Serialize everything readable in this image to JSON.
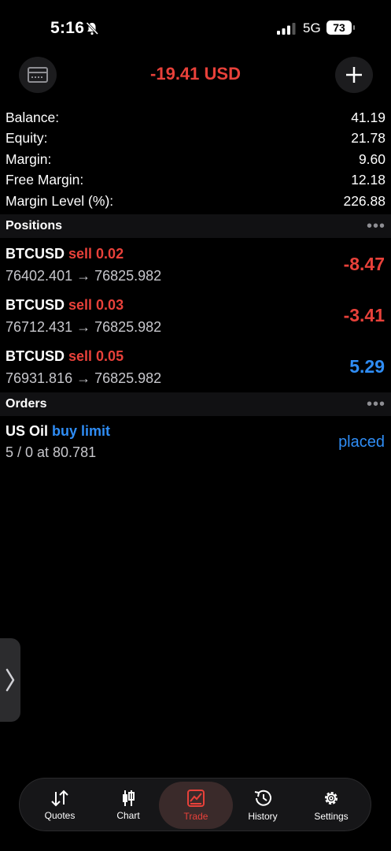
{
  "status_bar": {
    "time": "5:16",
    "network": "5G",
    "battery": "73"
  },
  "header": {
    "title": "-19.41 USD"
  },
  "summary": [
    {
      "label": "Balance:",
      "value": "41.19"
    },
    {
      "label": "Equity:",
      "value": "21.78"
    },
    {
      "label": "Margin:",
      "value": "9.60"
    },
    {
      "label": "Free Margin:",
      "value": "12.18"
    },
    {
      "label": "Margin Level (%):",
      "value": "226.88"
    }
  ],
  "positions": {
    "title": "Positions",
    "items": [
      {
        "symbol": "BTCUSD",
        "direction": "sell 0.02",
        "prices": "76402.401 → 76825.982",
        "profit": "-8.47"
      },
      {
        "symbol": "BTCUSD",
        "direction": "sell 0.03",
        "prices": "76712.431 → 76825.982",
        "profit": "-3.41"
      },
      {
        "symbol": "BTCUSD",
        "direction": "sell 0.05",
        "prices": "76931.816 → 76825.982",
        "profit": "5.29"
      }
    ]
  },
  "orders": {
    "title": "Orders",
    "items": [
      {
        "symbol": "US Oil",
        "direction": "buy limit",
        "details": "5 / 0 at 80.781",
        "state": "placed"
      }
    ]
  },
  "tabbar": {
    "tabs": [
      {
        "label": "Quotes",
        "icon": "quotes-arrows-icon"
      },
      {
        "label": "Chart",
        "icon": "candlestick-icon"
      },
      {
        "label": "Trade",
        "icon": "trade-chart-icon",
        "active": true
      },
      {
        "label": "History",
        "icon": "history-clock-icon"
      },
      {
        "label": "Settings",
        "icon": "gear-icon"
      }
    ]
  },
  "colors": {
    "negative": "#e8413a",
    "positive": "#2f8df5",
    "background": "#000000"
  }
}
